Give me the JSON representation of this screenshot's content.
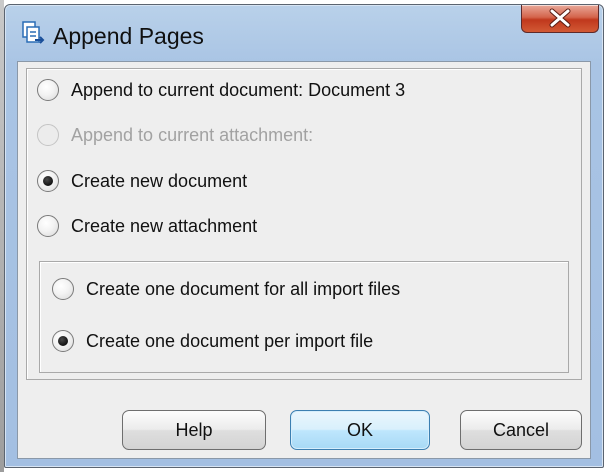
{
  "window": {
    "title": "Append Pages",
    "close_label": "X"
  },
  "options": [
    {
      "label": "Append to current document: Document 3",
      "selected": false,
      "enabled": true
    },
    {
      "label": "Append to current attachment:",
      "selected": false,
      "enabled": false
    },
    {
      "label": "Create new document",
      "selected": true,
      "enabled": true
    },
    {
      "label": "Create new attachment",
      "selected": false,
      "enabled": true
    }
  ],
  "sub_options": [
    {
      "label": "Create one document for all import files",
      "selected": false,
      "enabled": true
    },
    {
      "label": "Create one document per import file",
      "selected": true,
      "enabled": true
    }
  ],
  "buttons": {
    "help": "Help",
    "ok": "OK",
    "cancel": "Cancel"
  },
  "colors": {
    "title_bar": "#a9c4e4",
    "close_button": "#c8452b",
    "default_button": "#bee6fd",
    "dialog_background": "#eeeeee"
  },
  "icons": {
    "app": "append-pages-icon",
    "close": "close-icon"
  }
}
